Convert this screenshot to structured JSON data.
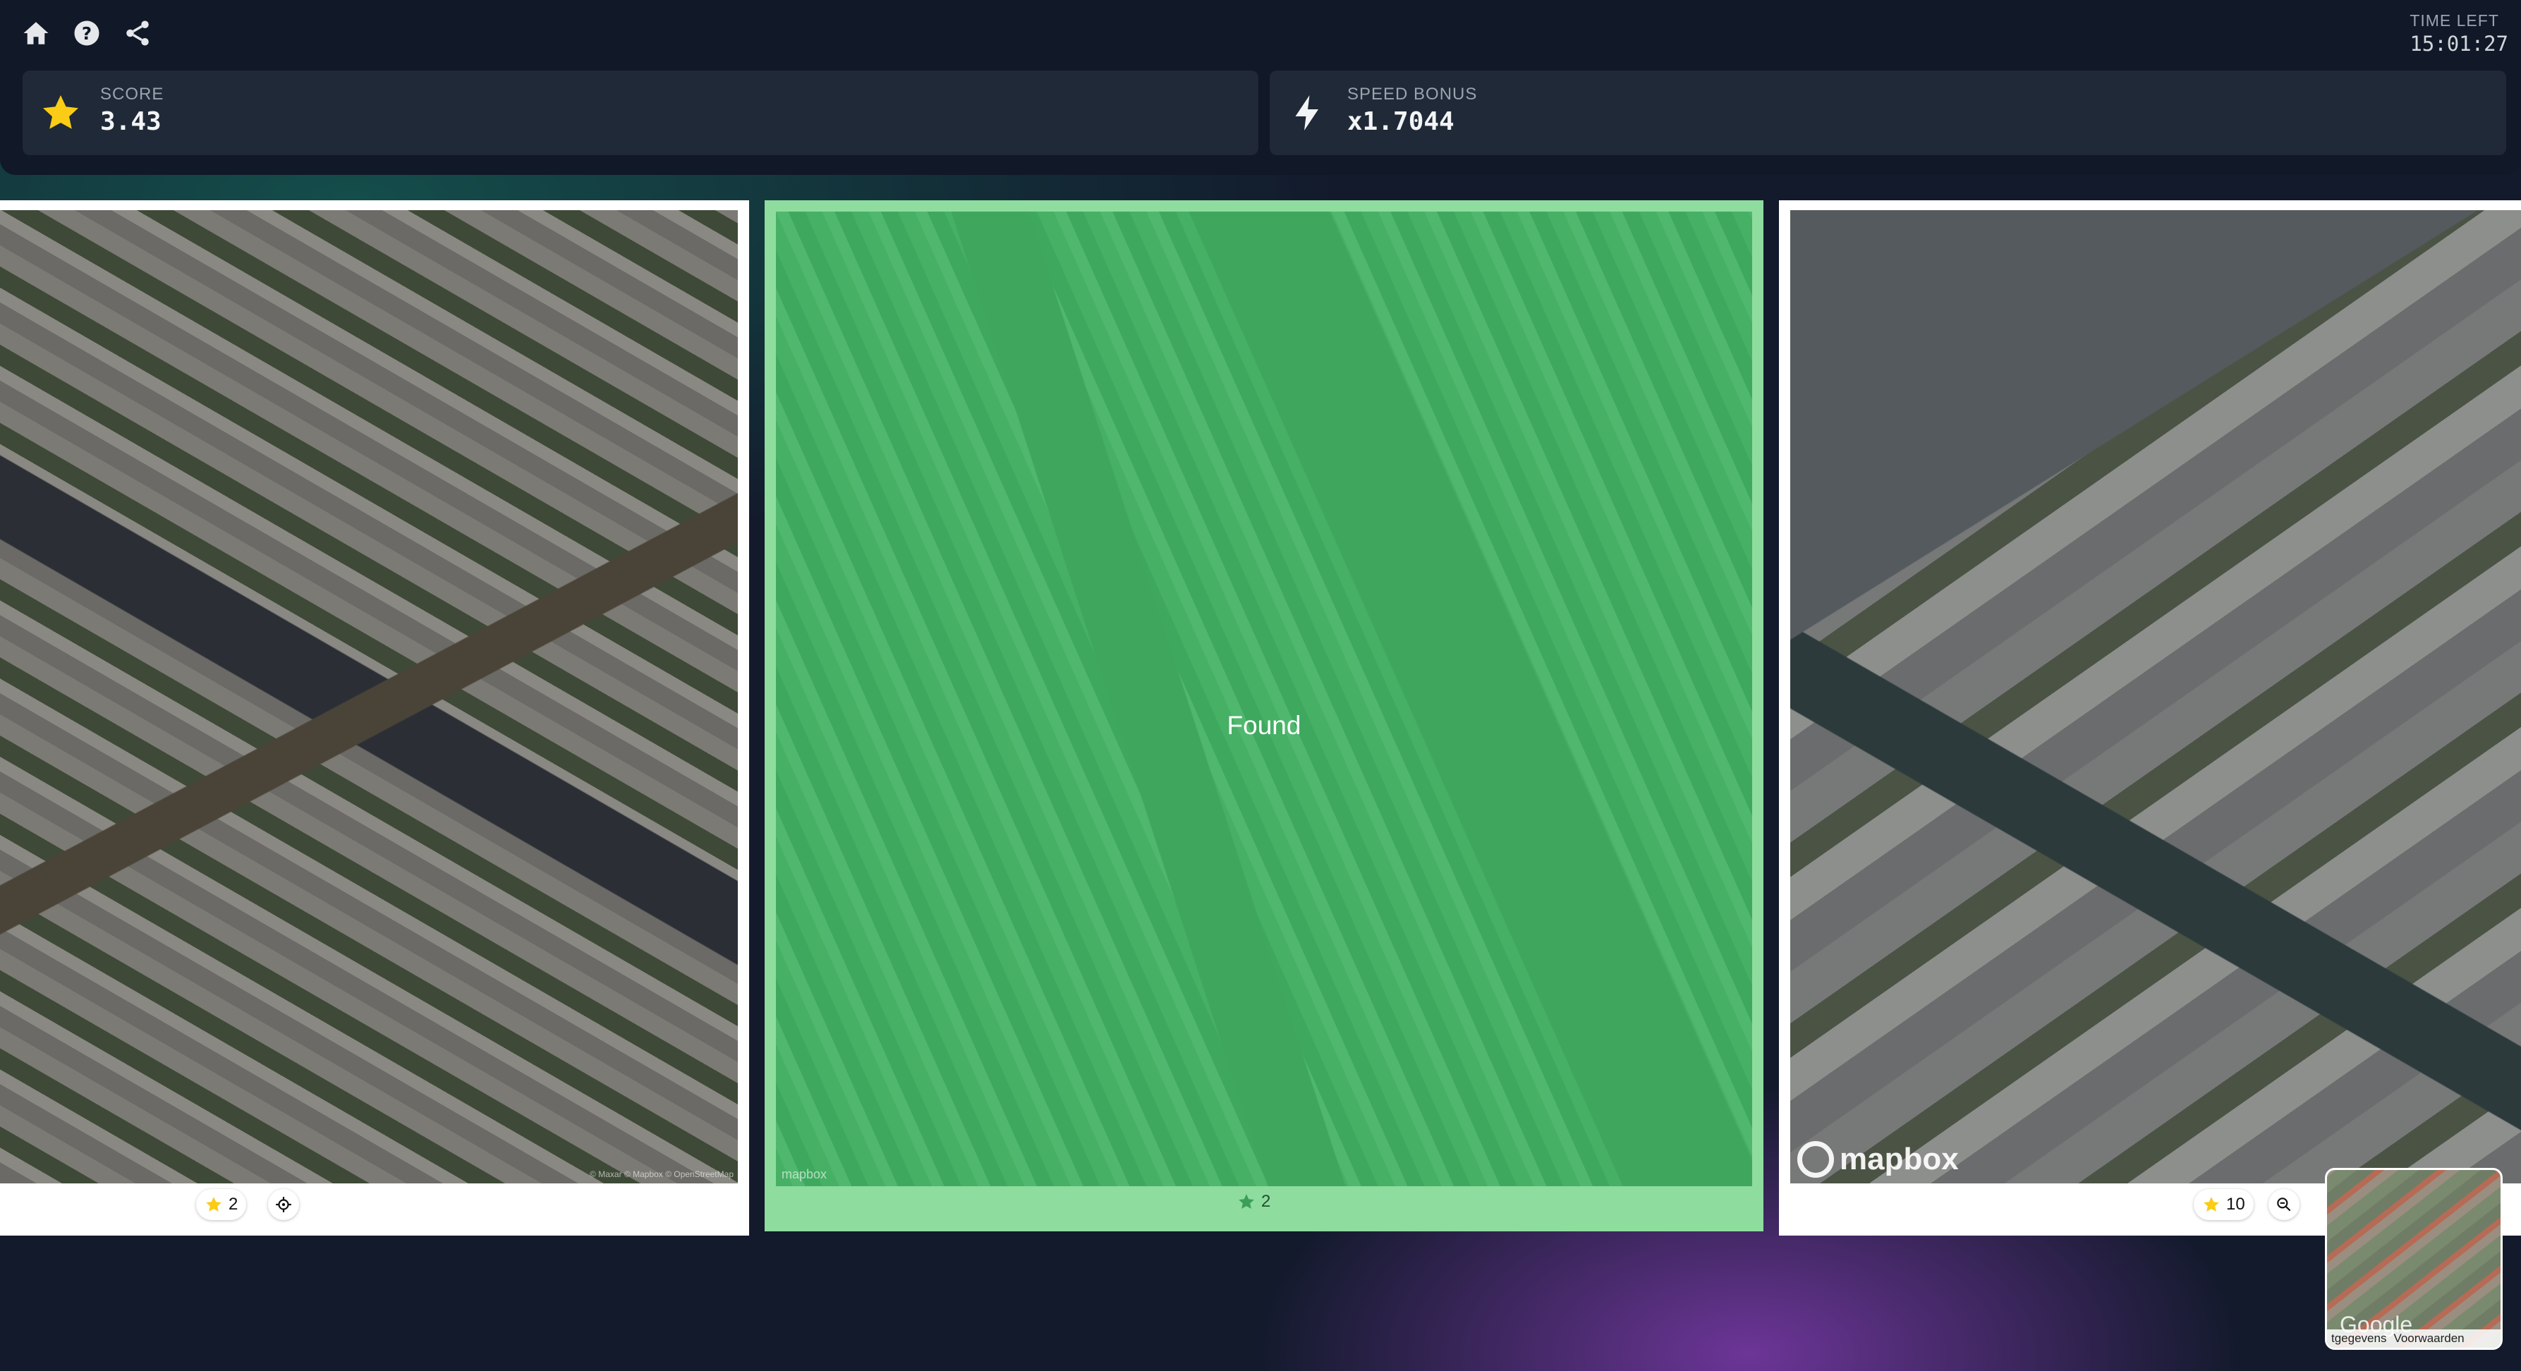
{
  "header": {
    "nav": [
      {
        "name": "home-icon"
      },
      {
        "name": "help-icon"
      },
      {
        "name": "share-icon"
      }
    ],
    "timer": {
      "label": "TIME LEFT",
      "value": "15:01:27"
    }
  },
  "stats": {
    "score": {
      "label": "SCORE",
      "value": "3.43",
      "icon": "star-icon",
      "color": "#facc15"
    },
    "speed_bonus": {
      "label": "SPEED BONUS",
      "value": "x1.7044",
      "icon": "bolt-icon"
    }
  },
  "cards": [
    {
      "id": "left",
      "stars": "2",
      "action_icon": "target-icon",
      "watermark": "© Maxar © Mapbox © OpenStreetMap"
    },
    {
      "id": "center",
      "status": "Found",
      "stars": "2",
      "watermark": "mapbox",
      "overlay_color": "#4cbe6e"
    },
    {
      "id": "right",
      "stars": "10",
      "action_icon": "zoom-icon",
      "watermark": "mapbox"
    }
  ],
  "minimap": {
    "brand": "Google",
    "attribution": [
      "tgegevens",
      "Voorwaarden"
    ]
  },
  "colors": {
    "background": "#111827",
    "card": "#1f2937",
    "found_border": "#8fdc9f",
    "star": "#facc15"
  }
}
